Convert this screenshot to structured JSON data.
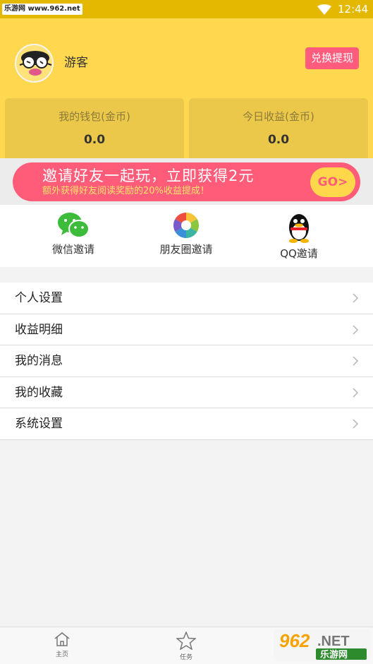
{
  "status_bar": {
    "watermark": "乐游网 www.962.net",
    "time": "12:44"
  },
  "profile": {
    "username": "游客",
    "withdraw_label": "兑换提现"
  },
  "stats": [
    {
      "label": "我的钱包(金币)",
      "value": "0.0"
    },
    {
      "label": "今日收益(金币)",
      "value": "0.0"
    }
  ],
  "banner": {
    "title": "邀请好友一起玩，立即获得2元",
    "subtitle": "额外获得好友阅读奖励的20%收益提成！",
    "go": "GO>"
  },
  "invite": [
    {
      "label": "微信邀请",
      "icon": "wechat-icon"
    },
    {
      "label": "朋友圈邀请",
      "icon": "moments-icon"
    },
    {
      "label": "QQ邀请",
      "icon": "qq-icon"
    }
  ],
  "menu": [
    {
      "label": "个人设置"
    },
    {
      "label": "收益明细"
    },
    {
      "label": "我的消息"
    },
    {
      "label": "我的收藏"
    },
    {
      "label": "系统设置"
    }
  ],
  "tabs": [
    {
      "label": "主页",
      "icon": "home-icon"
    },
    {
      "label": "任务",
      "icon": "star-icon"
    }
  ],
  "watermark_logo": {
    "text": "962",
    "suffix": ".NET",
    "brand": "乐游网"
  },
  "colors": {
    "accent": "#ffd84f",
    "pink": "#ff5c7a",
    "wechat": "#3dbb3b"
  }
}
